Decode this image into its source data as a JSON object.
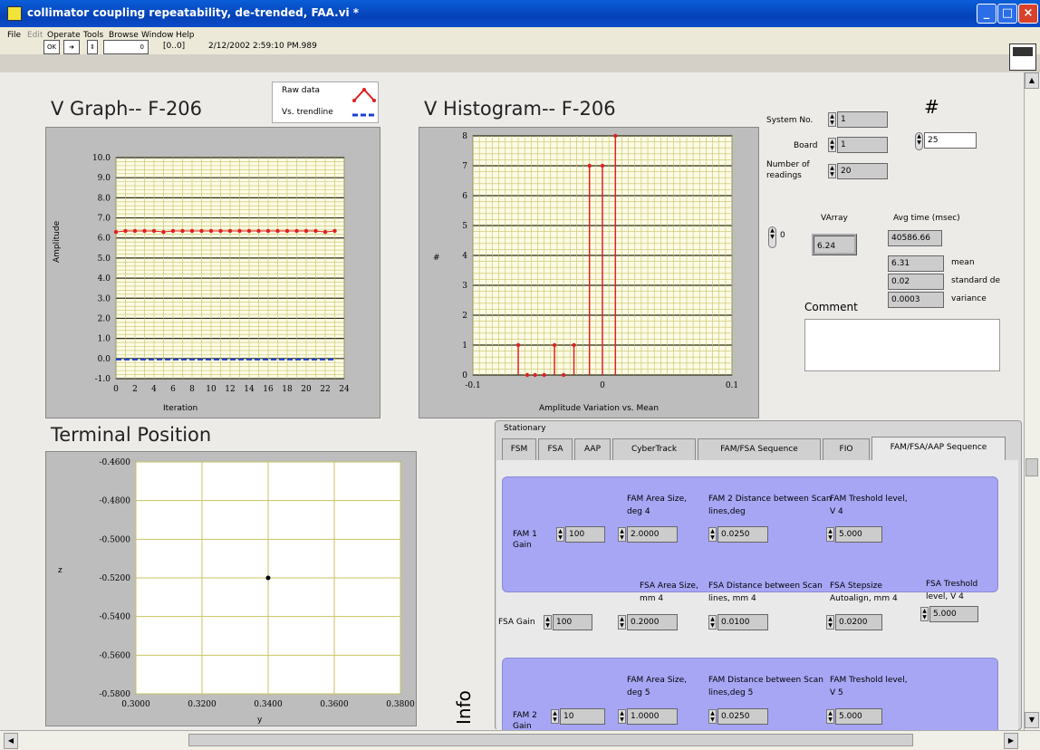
{
  "window": {
    "title": "collimator coupling repeatability, de-trended, FAA.vi *"
  },
  "menu": [
    "File",
    "Edit",
    "Operate",
    "Tools",
    "Browse",
    "Window",
    "Help"
  ],
  "toolbar": {
    "index": "[0..0]",
    "timestamp": "2/12/2002 2:59:10 PM.989"
  },
  "vgraph": {
    "title": "V Graph-- F-206",
    "legend_raw": "Raw data",
    "legend_trend": "Vs. trendline",
    "xlabel": "Iteration",
    "ylabel": "Amplitude"
  },
  "histogram": {
    "title": "V Histogram-- F-206",
    "xlabel": "Amplitude Variation vs. Mean",
    "ylabel": "#"
  },
  "terminal": {
    "title": "Terminal Position",
    "xlabel": "y",
    "ylabel": "z"
  },
  "chart_data": [
    {
      "type": "line",
      "title": "V Graph-- F-206",
      "xlabel": "Iteration",
      "ylabel": "Amplitude",
      "xlim": [
        0,
        24
      ],
      "ylim": [
        -1,
        10
      ],
      "x_ticks": [
        "0",
        "2",
        "4",
        "6",
        "8",
        "10",
        "12",
        "14",
        "16",
        "18",
        "20",
        "22",
        "24"
      ],
      "y_ticks": [
        "10.0",
        "9.0",
        "8.0",
        "7.0",
        "6.0",
        "5.0",
        "4.0",
        "3.0",
        "2.0",
        "1.0",
        "0.0",
        "-1.0"
      ],
      "series": [
        {
          "name": "Raw data",
          "color": "#e02020",
          "values": [
            6.3,
            6.35,
            6.35,
            6.35,
            6.35,
            6.3,
            6.35,
            6.35,
            6.35,
            6.35,
            6.35,
            6.35,
            6.35,
            6.35,
            6.35,
            6.35,
            6.35,
            6.35,
            6.35,
            6.35,
            6.35,
            6.35,
            6.3,
            6.35
          ]
        },
        {
          "name": "Vs. trendline",
          "color": "#1a3fd0",
          "values": [
            -0.05,
            -0.05,
            -0.05,
            -0.05,
            -0.05,
            -0.05,
            -0.05,
            -0.05,
            -0.05,
            -0.05,
            -0.05,
            -0.05,
            -0.05,
            -0.05,
            -0.05,
            -0.05,
            -0.05,
            -0.05,
            -0.05,
            -0.05,
            -0.05,
            -0.05,
            -0.05,
            -0.05
          ]
        }
      ]
    },
    {
      "type": "bar",
      "title": "V Histogram-- F-206",
      "xlabel": "Amplitude Variation vs. Mean",
      "ylabel": "#",
      "xlim": [
        -0.1,
        0.1
      ],
      "ylim": [
        0,
        8
      ],
      "x_ticks": [
        "-0.1",
        "0",
        "0.1"
      ],
      "y_ticks": [
        "8",
        "7",
        "6",
        "5",
        "4",
        "3",
        "2",
        "1",
        "0"
      ],
      "x": [
        -0.065,
        -0.058,
        -0.052,
        -0.045,
        -0.037,
        -0.03,
        -0.022,
        -0.01,
        0.0,
        0.01
      ],
      "values": [
        1,
        0,
        0,
        0,
        1,
        0,
        1,
        7,
        7,
        8
      ]
    },
    {
      "type": "scatter",
      "title": "Terminal Position",
      "xlabel": "y",
      "ylabel": "z",
      "xlim": [
        0.3,
        0.38
      ],
      "ylim": [
        -0.58,
        -0.46
      ],
      "x_ticks": [
        "0.3000",
        "0.3200",
        "0.3400",
        "0.3600",
        "0.3800"
      ],
      "y_ticks": [
        "-0.4600",
        "-0.4800",
        "-0.5000",
        "-0.5200",
        "-0.5400",
        "-0.5600",
        "-0.5800"
      ],
      "points": [
        {
          "x": 0.34,
          "y": -0.52
        }
      ]
    }
  ],
  "controls": {
    "system_no_label": "System No.",
    "system_no": "1",
    "board_label": "Board",
    "board": "1",
    "readings_label": "Number of readings",
    "readings": "20",
    "count_label": "#",
    "count": "25",
    "varray_label": "VArray",
    "varray_index": "0",
    "varray_value": "6.24",
    "avgtime_label": "Avg time (msec)",
    "avgtime": "40586.66",
    "mean": "6.31",
    "mean_label": "mean",
    "std": "0.02",
    "std_label": "standard de",
    "var": "0.0003",
    "var_label": "variance",
    "comment_label": "Comment",
    "comment": ""
  },
  "tabs": {
    "header": "Stationary",
    "items": [
      "FSM",
      "FSA",
      "AAP",
      "CyberTrack",
      "FAM/FSA Sequence",
      "FIO",
      "FAM/FSA/AAP Sequence"
    ],
    "active": 6
  },
  "fam1": {
    "gain_label": "FAM 1 Gain",
    "gain": "100",
    "area_label": "FAM Area Size, deg 4",
    "area": "2.0000",
    "dist_label": "FAM 2 Distance between Scan lines,deg",
    "dist": "0.0250",
    "thr_label": "FAM Treshold level, V 4",
    "thr": "5.000"
  },
  "fsa": {
    "gain_label": "FSA Gain",
    "gain": "100",
    "area_label": "FSA Area Size, mm 4",
    "area": "0.2000",
    "dist_label": "FSA Distance between Scan lines, mm 4",
    "dist": "0.0100",
    "step_label": "FSA Stepsize Autoalign, mm 4",
    "step": "0.0200",
    "thr_label": "FSA Treshold level, V 4",
    "thr": "5.000"
  },
  "fam2": {
    "gain_label": "FAM 2 Gain",
    "gain": "10",
    "area_label": "FAM Area Size, deg 5",
    "area": "1.0000",
    "dist_label": "FAM Distance between Scan lines,deg 5",
    "dist": "0.0250",
    "thr_label": "FAM Treshold level, V 5",
    "thr": "5.000"
  },
  "side_label": "Info"
}
